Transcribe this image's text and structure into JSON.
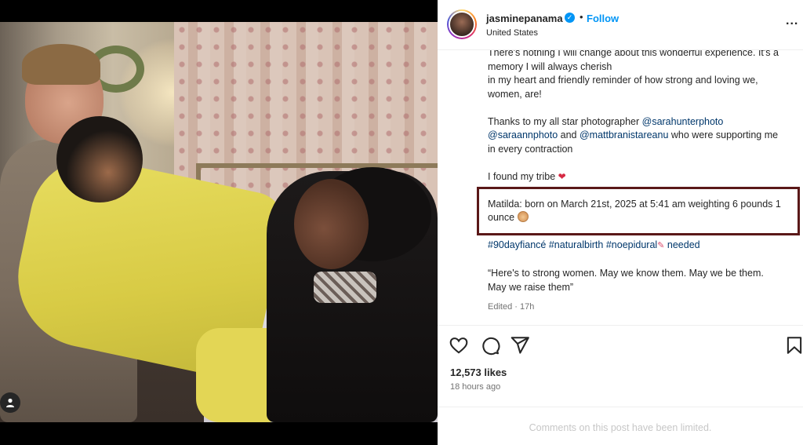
{
  "post": {
    "author": {
      "username": "jasminepanama",
      "verified": true,
      "location": "United States",
      "follow_label": "Follow",
      "separator": "•"
    },
    "more_label": "...",
    "caption": {
      "lines": [
        "There's nothing I will change about this wonderful experience. It's a",
        "memory I will always cherish",
        "in my heart and friendly reminder of how strong and loving we,",
        "women, are!"
      ],
      "thanks_prefix": "Thanks to my all star photographer ",
      "mention_1": "@sarahunterphoto",
      "mention_2": "@saraannphoto",
      "and_text": " and ",
      "mention_3": "@mattbranistareanu",
      "thanks_suffix_1": " who were supporting me",
      "thanks_suffix_2": "in every contraction",
      "tribe_text": "I found my tribe ",
      "heart_emoji": "❤",
      "birth_line_1": "Matilda: born on March 21st, 2025 at 5:41 am weighting 6 pounds 1",
      "birth_line_2": "ounce ",
      "hashtag_1": "#90dayfiancé",
      "hashtag_2": "#naturalbirth",
      "hashtag_3": "#noepidural",
      "rocket_emoji": "✎",
      "needed_text": "needed",
      "quote_line_1": "“Here's to strong women. May we know them. May we be them.",
      "quote_line_2": "May we raise them”",
      "edited": "Edited · 17h"
    },
    "likes": "12,573 likes",
    "time_ago": "18 hours ago",
    "comments_limited": "Comments on this post have been limited."
  },
  "icons": {
    "like": "heart-icon",
    "comment": "comment-icon",
    "share": "share-icon",
    "save": "bookmark-icon",
    "tag": "user-tag-icon"
  },
  "colors": {
    "link": "#00376b",
    "follow": "#0095f6",
    "highlight_box": "#5a1818"
  }
}
